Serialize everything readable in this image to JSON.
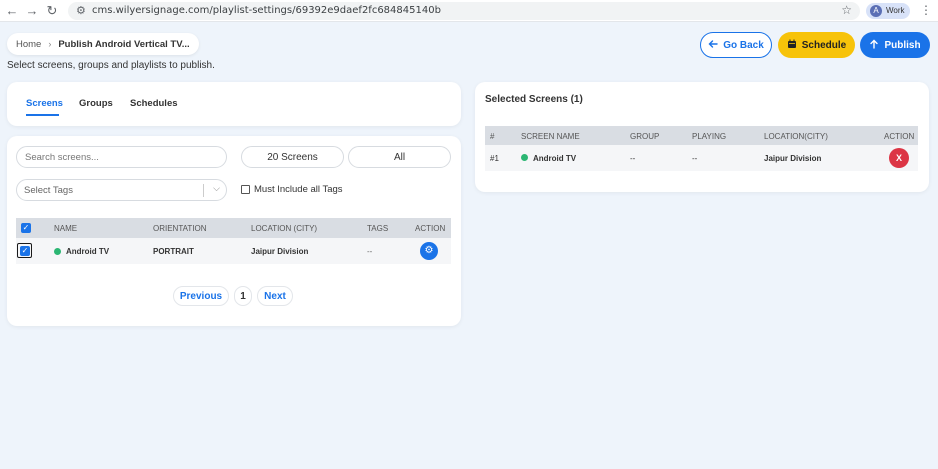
{
  "browser": {
    "url": "cms.wilyersignage.com/playlist-settings/69392e9daef2fc684845140b",
    "profile_initial": "A",
    "profile_label": "Work"
  },
  "breadcrumb": {
    "home": "Home",
    "current": "Publish Android Vertical TV..."
  },
  "subtitle": "Select screens, groups and playlists to publish.",
  "actions": {
    "go_back": "Go Back",
    "schedule": "Schedule",
    "publish": "Publish"
  },
  "tabs": [
    {
      "label": "Screens",
      "active": true
    },
    {
      "label": "Groups",
      "active": false
    },
    {
      "label": "Schedules",
      "active": false
    }
  ],
  "filters": {
    "search_placeholder": "Search screens...",
    "count_label": "20 Screens",
    "filter_all": "All",
    "tags_placeholder": "Select Tags",
    "must_include_label": "Must Include all Tags"
  },
  "screens_table": {
    "headers": [
      "NAME",
      "ORIENTATION",
      "LOCATION (CITY)",
      "TAGS",
      "ACTION"
    ],
    "rows": [
      {
        "name": "Android TV",
        "orientation": "PORTRAIT",
        "location": "Jaipur Division",
        "tags": "--",
        "status_color": "#2bb673"
      }
    ]
  },
  "pagination": {
    "previous": "Previous",
    "page": "1",
    "next": "Next"
  },
  "selected": {
    "title": "Selected Screens (1)",
    "headers": [
      "#",
      "SCREEN NAME",
      "GROUP",
      "PLAYING",
      "LOCATION(CITY)",
      "ACTION"
    ],
    "rows": [
      {
        "index": "#1",
        "name": "Android TV",
        "group": "--",
        "playing": "--",
        "location": "Jaipur Division",
        "remove": "X"
      }
    ]
  },
  "colors": {
    "primary": "#1a73e8",
    "schedule": "#f7c30a",
    "danger": "#dc3545",
    "online": "#2bb673"
  }
}
